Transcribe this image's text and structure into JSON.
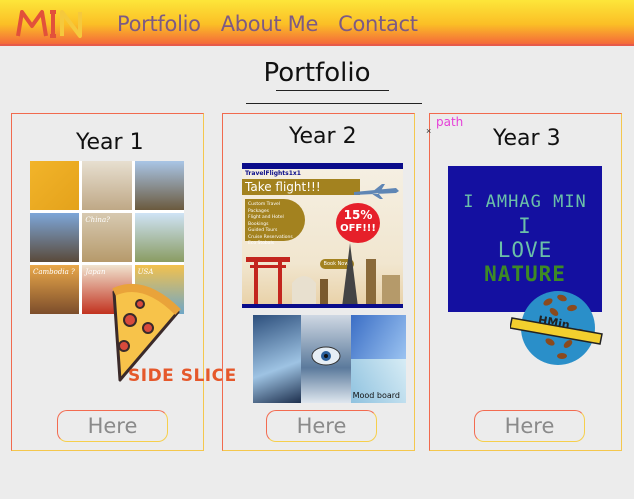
{
  "header": {
    "logo_text": "MIN",
    "nav": [
      "Portfolio",
      "About Me",
      "Contact"
    ]
  },
  "page": {
    "title": "Portfolio",
    "path_label": "path",
    "path_marker": "×"
  },
  "cards": [
    {
      "year": "Year 1",
      "button": "Here",
      "collage_captions": [
        "",
        "",
        "",
        "",
        "China?",
        "",
        "Cambodia ?",
        "Japan",
        "USA"
      ],
      "sticker_text": "SIDE SLICE"
    },
    {
      "year": "Year 2",
      "button": "Here",
      "poster": {
        "brand": "TravelFlights1x1",
        "headline": "Take flight!!!",
        "list": [
          "Custom Travel Packages",
          "Flight and Hotel Bookings",
          "Guided Tours",
          "Cruise Reservations",
          "Eco Stobals"
        ],
        "offer_top": "15%",
        "offer_bottom": "OFF!!!",
        "cta": "Book Now!"
      },
      "mood_board_label": "Mood board"
    },
    {
      "year": "Year 3",
      "button": "Here",
      "poster_lines": [
        "I AMHAG MIN",
        "I",
        "LOVE",
        "NATURE"
      ],
      "badge_text": "HMin"
    }
  ],
  "colors": {
    "header_top": "#fde63a",
    "header_bottom": "#f4693a",
    "nav_text": "#7d5a84",
    "card_border_a": "#f16a4e",
    "card_border_b": "#f4c74d",
    "path_label": "#e63fd8"
  }
}
